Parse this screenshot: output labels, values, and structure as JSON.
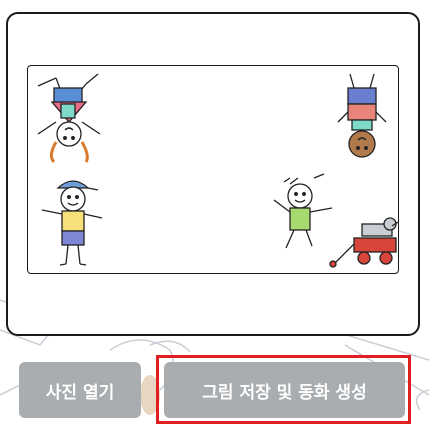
{
  "buttons": {
    "open_photo_label": "사진 열기",
    "save_and_generate_label": "그림 저장 및 동화 생성"
  },
  "colors": {
    "button_bg": "#a9adaf",
    "button_text": "#ffffff",
    "highlight_border": "#e02020",
    "card_border": "#1a1a1a"
  }
}
